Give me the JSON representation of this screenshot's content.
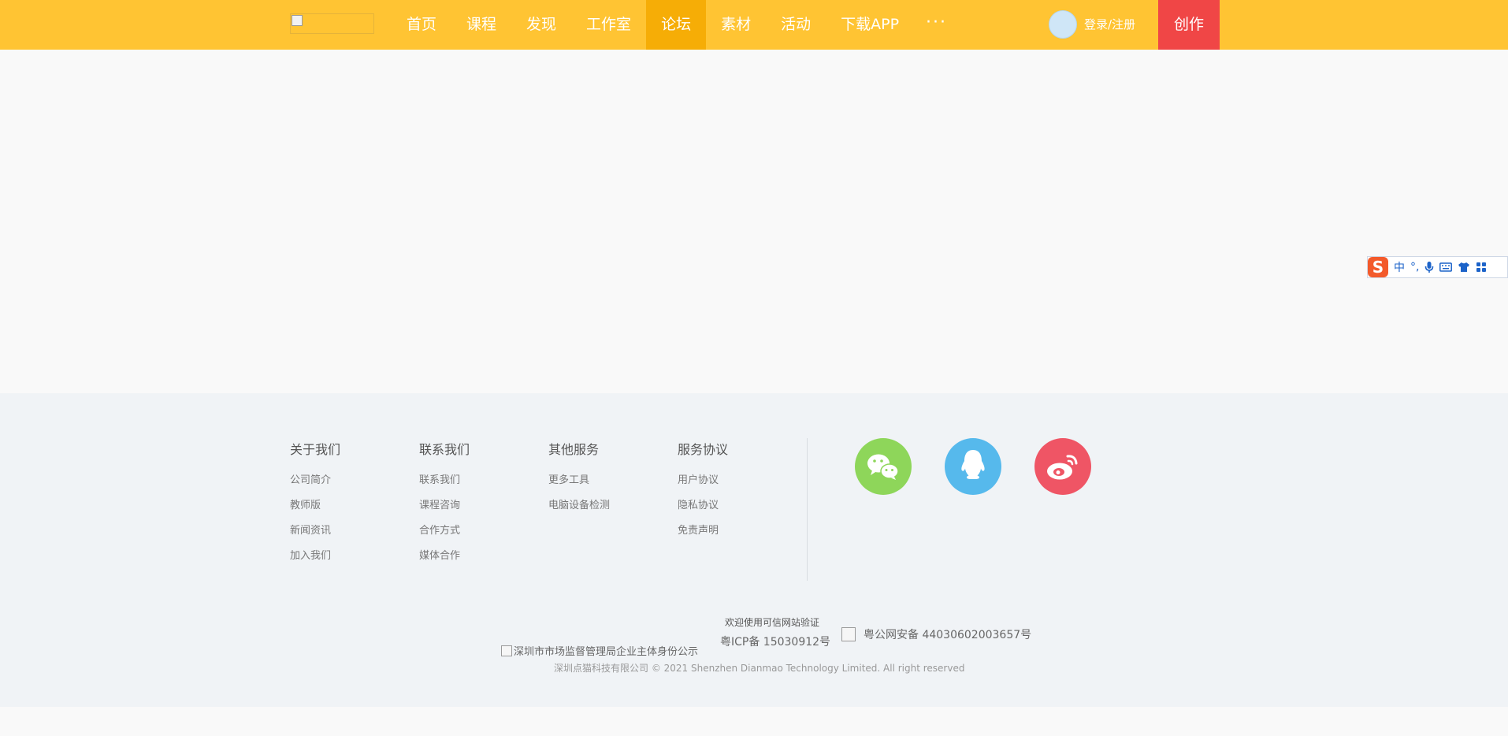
{
  "nav": {
    "items": [
      {
        "label": "首页"
      },
      {
        "label": "课程"
      },
      {
        "label": "发现"
      },
      {
        "label": "工作室"
      },
      {
        "label": "论坛"
      },
      {
        "label": "素材"
      },
      {
        "label": "活动"
      },
      {
        "label": "下载APP"
      }
    ],
    "active_index": 4,
    "more_label": "···",
    "login_label": "登录/注册",
    "create_label": "创作"
  },
  "ime": {
    "logo_letter": "S",
    "mode_label": "中",
    "punct_label": "°,"
  },
  "footer": {
    "columns": [
      {
        "title": "关于我们",
        "links": [
          "公司简介",
          "教师版",
          "新闻资讯",
          "加入我们"
        ]
      },
      {
        "title": "联系我们",
        "links": [
          "联系我们",
          "课程咨询",
          "合作方式",
          "媒体合作"
        ]
      },
      {
        "title": "其他服务",
        "links": [
          "更多工具",
          "电脑设备检测"
        ]
      },
      {
        "title": "服务协议",
        "links": [
          "用户协议",
          "隐私协议",
          "免责声明"
        ]
      }
    ],
    "social": [
      "wechat-icon",
      "qq-icon",
      "weibo-icon"
    ],
    "seal_alt": "深圳市市场监督管理局企业主体身份公示",
    "verify_text": "欢迎使用可信网站验证",
    "icp_text": "粤ICP备 15030912号",
    "police_text": "粤公网安备 44030602003657号",
    "copyright": "深圳点猫科技有限公司   © 2021 Shenzhen Dianmao Technology Limited. All right reserved"
  },
  "colors": {
    "topbar": "#ffc433",
    "active_nav": "#f6ad06",
    "create": "#f04646",
    "wechat": "#8ed65a",
    "qq": "#56b9ec",
    "weibo": "#ef5565"
  }
}
